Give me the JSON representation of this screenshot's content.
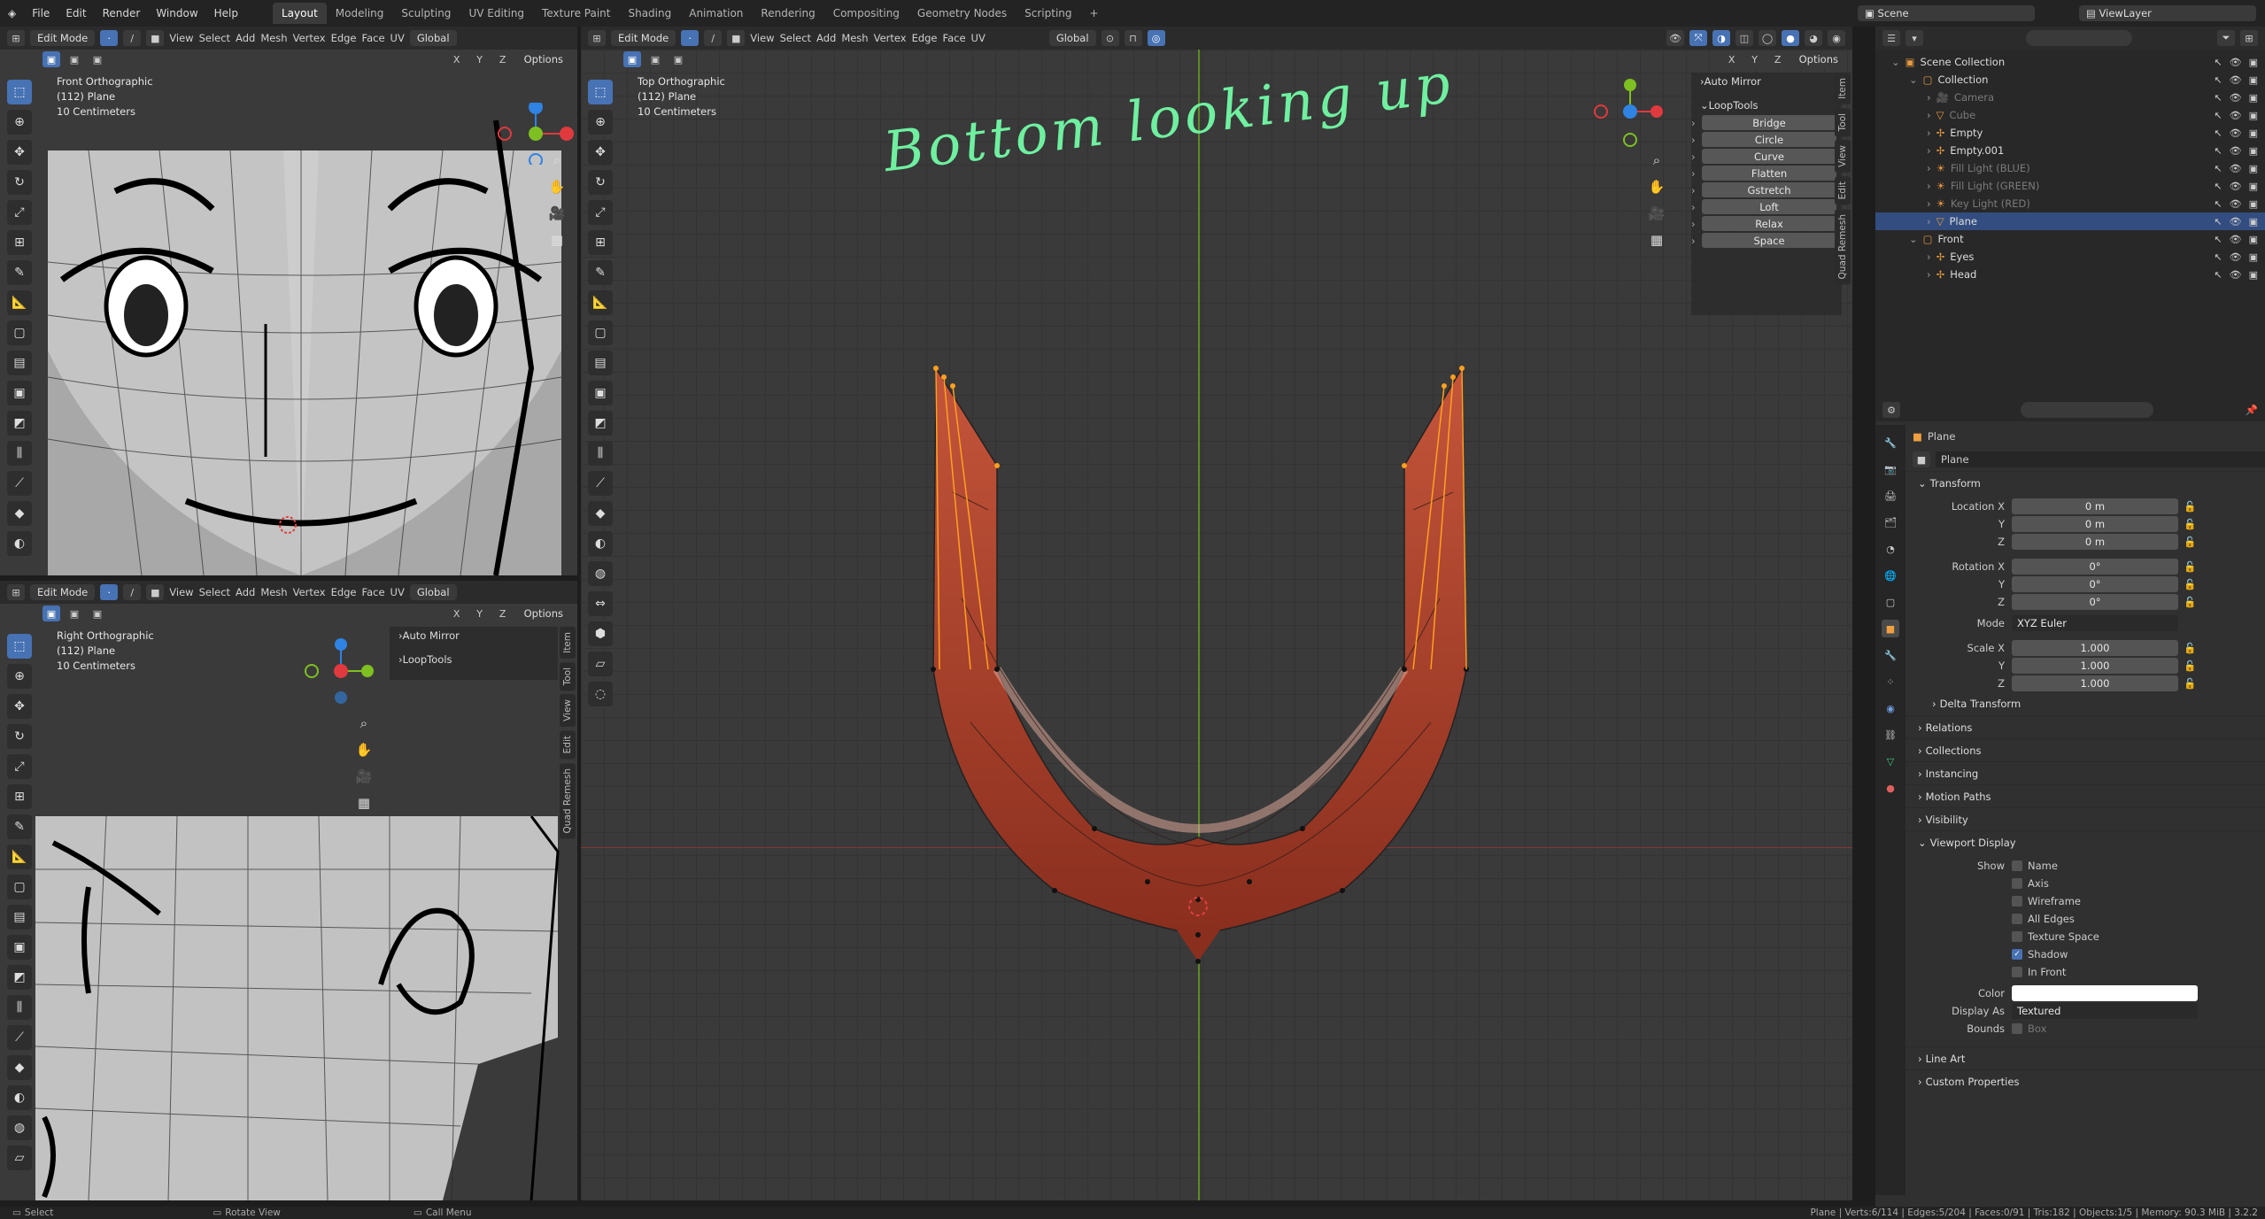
{
  "topmenu": {
    "items": [
      "File",
      "Edit",
      "Render",
      "Window",
      "Help"
    ],
    "workspaces": [
      "Layout",
      "Modeling",
      "Sculpting",
      "UV Editing",
      "Texture Paint",
      "Shading",
      "Animation",
      "Rendering",
      "Compositing",
      "Geometry Nodes",
      "Scripting"
    ],
    "active_workspace": "Layout",
    "add_tab": "+",
    "scene_label": "Scene",
    "viewlayer_label": "ViewLayer"
  },
  "viewport_header": {
    "mode": "Edit Mode",
    "menus": [
      "View",
      "Select",
      "Add",
      "Mesh",
      "Vertex",
      "Edge",
      "Face",
      "UV"
    ],
    "orientation": "Global",
    "options": "Options",
    "axes": [
      "X",
      "Y",
      "Z"
    ]
  },
  "vp_front": {
    "view_name": "Front Orthographic",
    "object": "(112) Plane",
    "scale": "10 Centimeters"
  },
  "vp_right": {
    "view_name": "Right Orthographic",
    "object": "(112) Plane",
    "scale": "10 Centimeters",
    "npanel": {
      "auto_mirror": "Auto Mirror",
      "looptools": "LoopTools"
    },
    "side_tabs": [
      "Item",
      "Tool",
      "View",
      "Edit",
      "Quad Remesh"
    ]
  },
  "vp_top": {
    "view_name": "Top Orthographic",
    "object": "(112) Plane",
    "scale": "10 Centimeters",
    "annotation": "Bottom looking up",
    "npanel": {
      "auto_mirror": "Auto Mirror",
      "looptools": "LoopTools",
      "buttons": [
        "Bridge",
        "Circle",
        "Curve",
        "Flatten",
        "Gstretch",
        "Loft",
        "Relax",
        "Space"
      ]
    },
    "side_tabs": [
      "Item",
      "Tool",
      "View",
      "Edit",
      "Quad Remesh"
    ]
  },
  "outliner": {
    "search_placeholder": "",
    "rows": [
      {
        "label": "Scene Collection",
        "indent": 0,
        "icon": "scene-collection-icon"
      },
      {
        "label": "Collection",
        "indent": 1,
        "icon": "collection-icon"
      },
      {
        "label": "Camera",
        "indent": 2,
        "icon": "camera-icon",
        "dim": true
      },
      {
        "label": "Cube",
        "indent": 2,
        "icon": "mesh-icon",
        "dim": true
      },
      {
        "label": "Empty",
        "indent": 2,
        "icon": "empty-icon"
      },
      {
        "label": "Empty.001",
        "indent": 2,
        "icon": "empty-icon"
      },
      {
        "label": "Fill Light (BLUE)",
        "indent": 2,
        "icon": "light-icon",
        "dim": true
      },
      {
        "label": "Fill Light (GREEN)",
        "indent": 2,
        "icon": "light-icon",
        "dim": true
      },
      {
        "label": "Key Light (RED)",
        "indent": 2,
        "icon": "light-icon",
        "dim": true
      },
      {
        "label": "Plane",
        "indent": 2,
        "icon": "mesh-icon",
        "selected": true
      },
      {
        "label": "Front",
        "indent": 1,
        "icon": "collection-icon"
      },
      {
        "label": "Eyes",
        "indent": 2,
        "icon": "empty-icon"
      },
      {
        "label": "Head",
        "indent": 2,
        "icon": "empty-icon"
      }
    ]
  },
  "properties": {
    "object_name": "Plane",
    "datablock": "Plane",
    "transform": {
      "title": "Transform",
      "location_label": "Location X",
      "rotation_label": "Rotation X",
      "scale_label": "Scale X",
      "y": "Y",
      "z": "Z",
      "location": [
        "0 m",
        "0 m",
        "0 m"
      ],
      "rotation": [
        "0°",
        "0°",
        "0°"
      ],
      "mode_label": "Mode",
      "mode": "XYZ Euler",
      "scale": [
        "1.000",
        "1.000",
        "1.000"
      ],
      "delta": "Delta Transform"
    },
    "sections": [
      "Relations",
      "Collections",
      "Instancing",
      "Motion Paths",
      "Visibility"
    ],
    "viewport_display": {
      "title": "Viewport Display",
      "show_label": "Show",
      "toggles": [
        {
          "label": "Name",
          "on": false
        },
        {
          "label": "Axis",
          "on": false
        },
        {
          "label": "Wireframe",
          "on": false
        },
        {
          "label": "All Edges",
          "on": false
        },
        {
          "label": "Texture Space",
          "on": false
        },
        {
          "label": "Shadow",
          "on": true
        },
        {
          "label": "In Front",
          "on": false
        }
      ],
      "color_label": "Color",
      "display_as_label": "Display As",
      "display_as": "Textured",
      "bounds_label": "Bounds",
      "bounds": "Box"
    },
    "bottom_sections": [
      "Line Art",
      "Custom Properties"
    ]
  },
  "statusbar": {
    "select": "Select",
    "rotate": "Rotate View",
    "call_menu": "Call Menu",
    "stats": "Plane | Verts:6/114 | Edges:5/204 | Faces:0/91 | Tris:182 | Objects:1/5 | Memory: 90.3 MiB | 3.2.2"
  },
  "colors": {
    "accent": "#4772b3",
    "mesh_red": "#b2442c",
    "selected_vertex": "#ffa020",
    "annotation": "#6ff0a0",
    "axis_x": "#e0393e",
    "axis_y": "#7ec021",
    "axis_z": "#2f83e3"
  }
}
